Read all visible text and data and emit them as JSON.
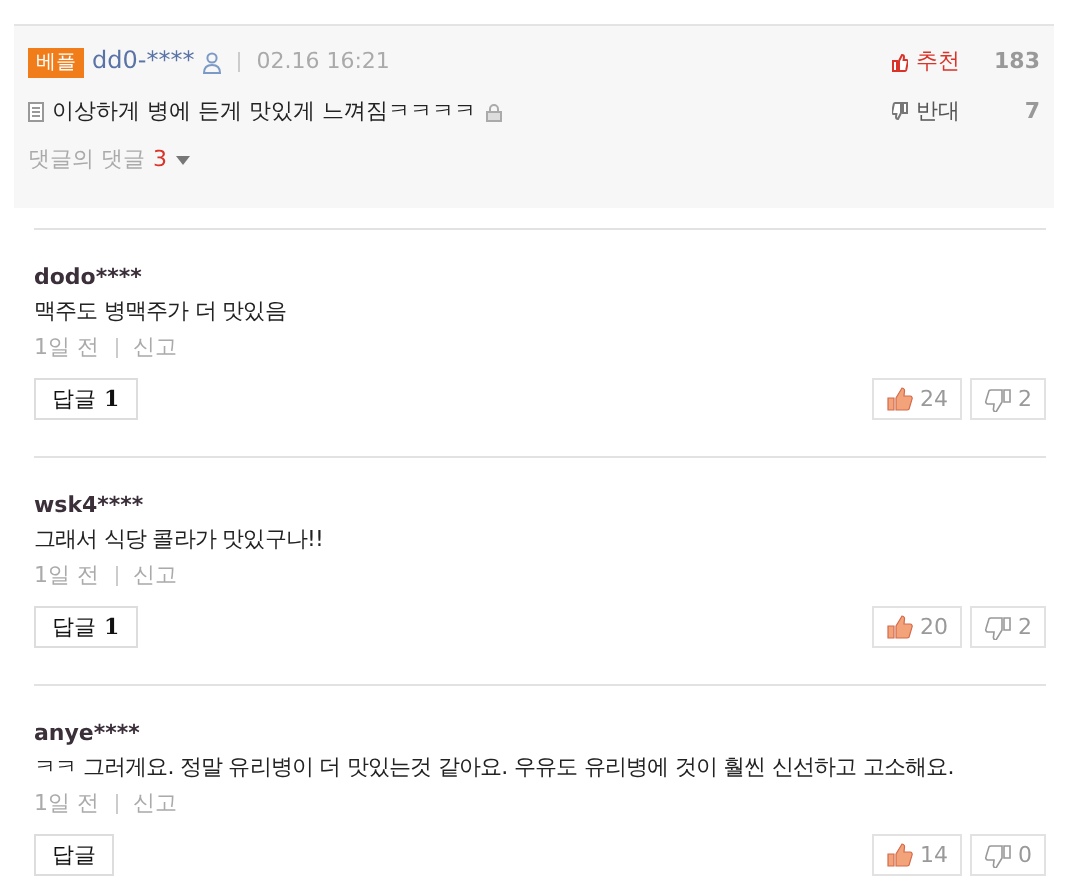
{
  "best_comment": {
    "badge": "베플",
    "user": "dd0-****",
    "date": "02.16 16:21",
    "text": "이상하게 병에 든게 맛있게 느껴짐ㅋㅋㅋㅋ",
    "recommend_label": "추천",
    "recommend_count": "183",
    "oppose_label": "반대",
    "oppose_count": "7",
    "replies_label": "댓글의 댓글",
    "replies_count": "3"
  },
  "comments": [
    {
      "user": "dodo****",
      "text": "맥주도 병맥주가 더 맛있음",
      "time": "1일 전",
      "report": "신고",
      "reply_label": "답글",
      "reply_count": "1",
      "likes": "24",
      "dislikes": "2"
    },
    {
      "user": "wsk4****",
      "text": "그래서 식당 콜라가 맛있구나!!",
      "time": "1일 전",
      "report": "신고",
      "reply_label": "답글",
      "reply_count": "1",
      "likes": "20",
      "dislikes": "2"
    },
    {
      "user": "anye****",
      "text": "ㅋㅋ 그러게요. 정말 유리병이 더 맛있는것 같아요. 우유도 유리병에 것이 훨씬 신선하고 고소해요.",
      "time": "1일 전",
      "report": "신고",
      "reply_label": "답글",
      "likes": "14",
      "dislikes": "0"
    }
  ]
}
